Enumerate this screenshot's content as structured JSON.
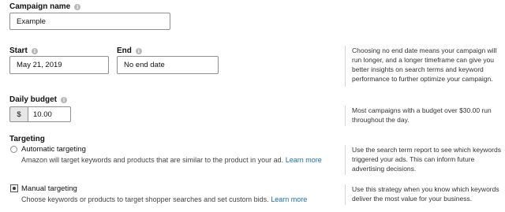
{
  "campaign_name": {
    "label": "Campaign name",
    "value": "Example"
  },
  "start": {
    "label": "Start",
    "value": "May 21, 2019"
  },
  "end": {
    "label": "End",
    "value": "No end date"
  },
  "end_help": "Choosing no end date means your campaign will run longer, and a longer timeframe can give you better insights on search terms and keyword performance to further optimize your campaign.",
  "daily_budget": {
    "label": "Daily budget",
    "currency": "$",
    "value": "10.00"
  },
  "budget_help": "Most campaigns with a budget over $30.00 run throughout the day.",
  "targeting": {
    "label": "Targeting",
    "automatic": {
      "title": "Automatic targeting",
      "desc": "Amazon will target keywords and products that are similar to the product in your ad.",
      "learn_more": "Learn more",
      "selected": false,
      "help": "Use the search term report to see which keywords triggered your ads. This can inform future advertising decisions."
    },
    "manual": {
      "title": "Manual targeting",
      "desc": "Choose keywords or products to target shopper searches and set custom bids.",
      "learn_more": "Learn more",
      "selected": true,
      "help": "Use this strategy when you know which keywords deliver the most value for your business."
    }
  },
  "icons": {
    "info": "info-icon",
    "radio_unchecked": "radio-unchecked-icon",
    "radio_checked": "radio-checked-icon"
  },
  "colors": {
    "link": "#1a6db5",
    "border": "#8f8f8f",
    "help_rule": "#d6d6d6"
  }
}
